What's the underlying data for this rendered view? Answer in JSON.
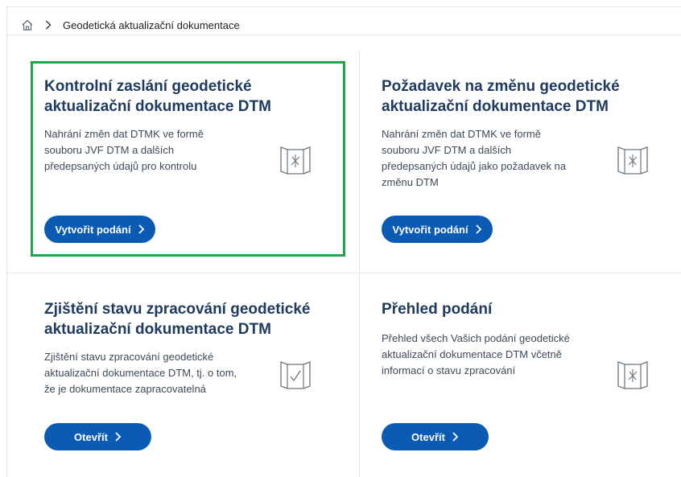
{
  "breadcrumb": {
    "home_icon": "home-icon",
    "separator_icon": "chevron-right-icon",
    "current": "Geodetická aktualizační dokumentace"
  },
  "cards": [
    {
      "title": "Kontrolní zaslání geodetické aktualizační dokumentace DTM",
      "description": "Nahrání změn dat DTMK ve formě souboru JVF DTM a dalších předepsaných údajů pro kontrolu",
      "icon": "map-document-icon",
      "button_label": "Vytvořit podání",
      "selected": true
    },
    {
      "title": "Požadavek na změnu geodetické aktualizační dokumentace DTM",
      "description": "Nahrání změn dat DTMK ve formě souboru JVF DTM a dalších předepsaných údajů jako požadavek na změnu DTM",
      "icon": "map-document-icon",
      "button_label": "Vytvořit podání"
    },
    {
      "title": "Zjištění stavu zpracování geodetické aktualizační dokumentace DTM",
      "description": "Zjištění stavu zpracování geodetické aktualizační dokumentace DTM, tj. o tom, že je dokumentace zapracovatelná",
      "icon": "map-check-icon",
      "button_label": "Otevřít"
    },
    {
      "title": "Přehled podání",
      "description": "Přehled všech Vašich podání geodetické aktualizační dokumentace DTM včetně informací o stavu zpracování",
      "icon": "map-document-icon",
      "button_label": "Otevřít"
    }
  ],
  "colors": {
    "title": "#1f3a5f",
    "button": "#0b5bb5",
    "highlight_border": "#1ea84a"
  }
}
